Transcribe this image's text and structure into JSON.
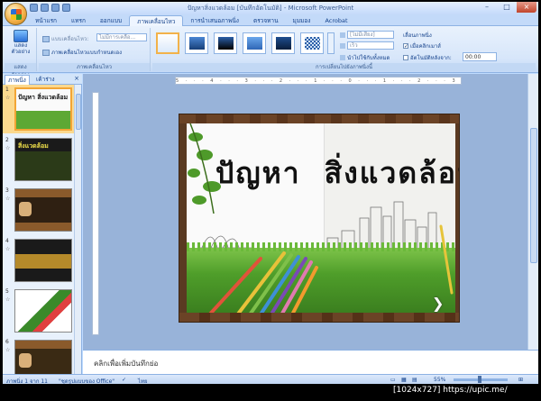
{
  "window": {
    "title": "ปัญหาสิ่งแวดล้อม [บันทึกอัตโนมัติ] - Microsoft PowerPoint"
  },
  "tabs": [
    "หน้าแรก",
    "แทรก",
    "ออกแบบ",
    "ภาพเคลื่อนไหว",
    "การนำเสนอภาพนิ่ง",
    "ตรวจทาน",
    "มุมมอง",
    "Acrobat"
  ],
  "ribbon": {
    "preview": {
      "label": "แสดงตัวอย่าง",
      "group": "แสดงตัวอย่าง"
    },
    "animations": {
      "animate_label": "แบบเคลื่อนไหว:",
      "animate_value": "ไม่มีการเคลื่อ...",
      "custom_label": "ภาพเคลื่อนไหวแบบกำหนดเอง",
      "group": "ภาพเคลื่อนไหว"
    },
    "transition": {
      "group": "การเปลี่ยนไปยังภาพนิ่งนี้",
      "sound_value": "[ไม่มีเสียง]",
      "speed_value": "เร็ว",
      "apply_all": "นำไปใช้กับทั้งหมด",
      "advance_label": "เลื่อนภาพนิ่ง",
      "on_click": "เมื่อคลิกเมาส์",
      "auto_after": "อัตโนมัติหลังจาก:",
      "time_value": "00:00"
    }
  },
  "left_panel": {
    "tab_slides": "ภาพนิ่ง",
    "tab_outline": "เค้าร่าง",
    "close": "×",
    "slides": [
      {
        "num": "1",
        "title": "ปัญหา สิ่งแวดล้อม"
      },
      {
        "num": "2",
        "title": "สิ่งแวดล้อม"
      },
      {
        "num": "3",
        "title": ""
      },
      {
        "num": "4",
        "title": ""
      },
      {
        "num": "5",
        "title": ""
      },
      {
        "num": "6",
        "title": ""
      }
    ]
  },
  "slide": {
    "title_word1": "ปัญหา",
    "title_word2": "สิ่งแวดล้อม"
  },
  "ruler": {
    "marks": "5 · · · 4 · · · 3 · · · 2 · · · 1 · · · 0 · · · 1 · · · 2 · · · 3 · · · 4 · · · 5"
  },
  "notes": {
    "placeholder": "คลิกเพื่อเพิ่มบันทึกย่อ"
  },
  "status": {
    "slide_pos": "ภาพนิ่ง 1 จาก 11",
    "theme": "\"ชุดรูปแบบของ Office\"",
    "language": "ไทย",
    "zoom": "55%"
  },
  "watermark": "[1024x727] https://upic.me/"
}
